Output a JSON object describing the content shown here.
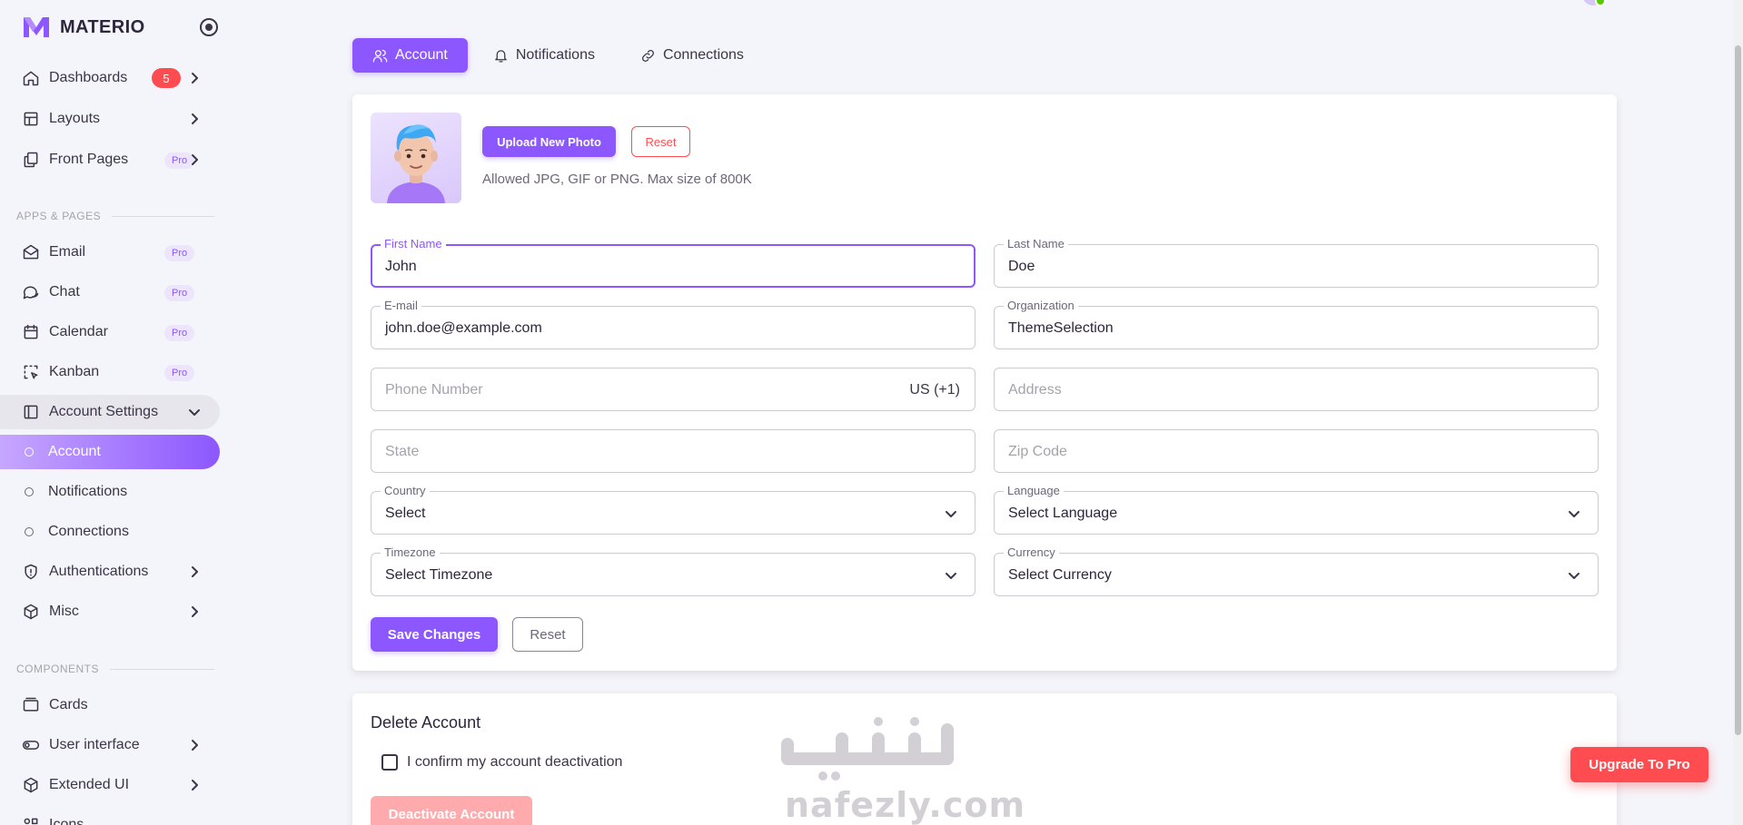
{
  "brand": {
    "name": "MATERIO",
    "accent": "#8c57ff"
  },
  "sidebar": {
    "items": [
      {
        "label": "Dashboards",
        "icon": "home-icon",
        "badge": "5"
      },
      {
        "label": "Layouts",
        "icon": "layout-icon"
      },
      {
        "label": "Front Pages",
        "icon": "pages-icon",
        "badge": "Pro"
      }
    ],
    "section_apps": "APPS & PAGES",
    "apps": [
      {
        "label": "Email",
        "icon": "mail-icon",
        "badge": "Pro"
      },
      {
        "label": "Chat",
        "icon": "chat-icon",
        "badge": "Pro"
      },
      {
        "label": "Calendar",
        "icon": "calendar-icon",
        "badge": "Pro"
      },
      {
        "label": "Kanban",
        "icon": "kanban-icon",
        "badge": "Pro"
      },
      {
        "label": "Account Settings",
        "icon": "account-settings-icon"
      },
      {
        "label": "Account"
      },
      {
        "label": "Notifications"
      },
      {
        "label": "Connections"
      },
      {
        "label": "Authentications",
        "icon": "shield-icon"
      },
      {
        "label": "Misc",
        "icon": "cube-icon"
      }
    ],
    "section_components": "COMPONENTS",
    "components": [
      {
        "label": "Cards",
        "icon": "cards-icon"
      },
      {
        "label": "User interface",
        "icon": "toggle-icon"
      },
      {
        "label": "Extended UI",
        "icon": "box-icon"
      },
      {
        "label": "Icons",
        "icon": "icons-icon"
      }
    ]
  },
  "tabs": [
    {
      "label": "Account",
      "icon": "users-icon",
      "active": true
    },
    {
      "label": "Notifications",
      "icon": "bell-icon"
    },
    {
      "label": "Connections",
      "icon": "link-icon"
    }
  ],
  "profile": {
    "upload_label": "Upload New Photo",
    "reset_label": "Reset",
    "hint": "Allowed JPG, GIF or PNG. Max size of 800K"
  },
  "form": {
    "first_name": {
      "label": "First Name",
      "value": "John"
    },
    "last_name": {
      "label": "Last Name",
      "value": "Doe"
    },
    "email": {
      "label": "E-mail",
      "value": "john.doe@example.com"
    },
    "organization": {
      "label": "Organization",
      "value": "ThemeSelection"
    },
    "phone": {
      "placeholder": "Phone Number",
      "suffix": "US (+1)"
    },
    "address": {
      "placeholder": "Address"
    },
    "state": {
      "placeholder": "State"
    },
    "zip": {
      "placeholder": "Zip Code"
    },
    "country": {
      "label": "Country",
      "value": "Select"
    },
    "language": {
      "label": "Language",
      "value": "Select Language"
    },
    "timezone": {
      "label": "Timezone",
      "value": "Select Timezone"
    },
    "currency": {
      "label": "Currency",
      "value": "Select Currency"
    },
    "save_label": "Save Changes",
    "reset_label": "Reset"
  },
  "delete_account": {
    "title": "Delete Account",
    "confirm_label": "I confirm my account deactivation",
    "button_label": "Deactivate Account"
  },
  "upgrade_label": "Upgrade To Pro",
  "watermark": {
    "text": "nafezly.com"
  },
  "colors": {
    "primary": "#8c57ff",
    "error": "#ff4c51",
    "background": "#f4f5fa"
  }
}
